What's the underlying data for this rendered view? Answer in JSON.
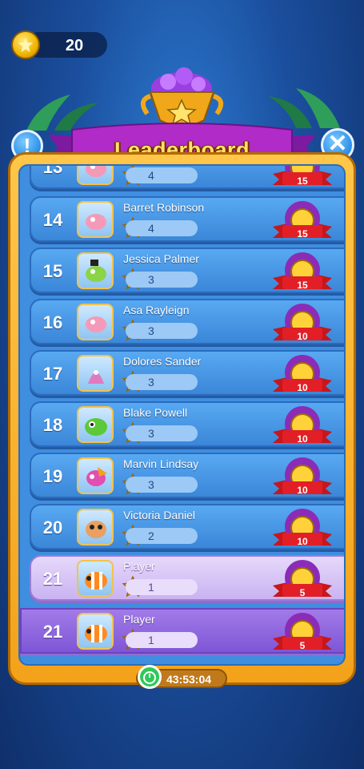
{
  "coins": {
    "value": "20"
  },
  "header": {
    "title": "Leaderboard"
  },
  "buttons": {
    "info_label": "!",
    "close_label": "✕"
  },
  "rows": [
    {
      "rank": "13",
      "name": "",
      "stars": "4",
      "reward": "15"
    },
    {
      "rank": "14",
      "name": "Barret Robinson",
      "stars": "4",
      "reward": "15"
    },
    {
      "rank": "15",
      "name": "Jessica Palmer",
      "stars": "3",
      "reward": "15"
    },
    {
      "rank": "16",
      "name": "Asa Rayleign",
      "stars": "3",
      "reward": "10"
    },
    {
      "rank": "17",
      "name": "Dolores Sander",
      "stars": "3",
      "reward": "10"
    },
    {
      "rank": "18",
      "name": "Blake Powell",
      "stars": "3",
      "reward": "10"
    },
    {
      "rank": "19",
      "name": "Marvin Lindsay",
      "stars": "3",
      "reward": "10"
    },
    {
      "rank": "20",
      "name": "Victoria Daniel",
      "stars": "2",
      "reward": "10"
    },
    {
      "rank": "21",
      "name": "Player",
      "stars": "1",
      "reward": "5"
    }
  ],
  "player_row": {
    "rank": "21",
    "name": "Player",
    "stars": "1",
    "reward": "5"
  },
  "timer": {
    "value": "43:53:04"
  },
  "colors": {
    "panel": "#f3a21a",
    "row": "#3b86d8",
    "player_row": "#c9b3f1",
    "banner": "#b02bc8"
  }
}
